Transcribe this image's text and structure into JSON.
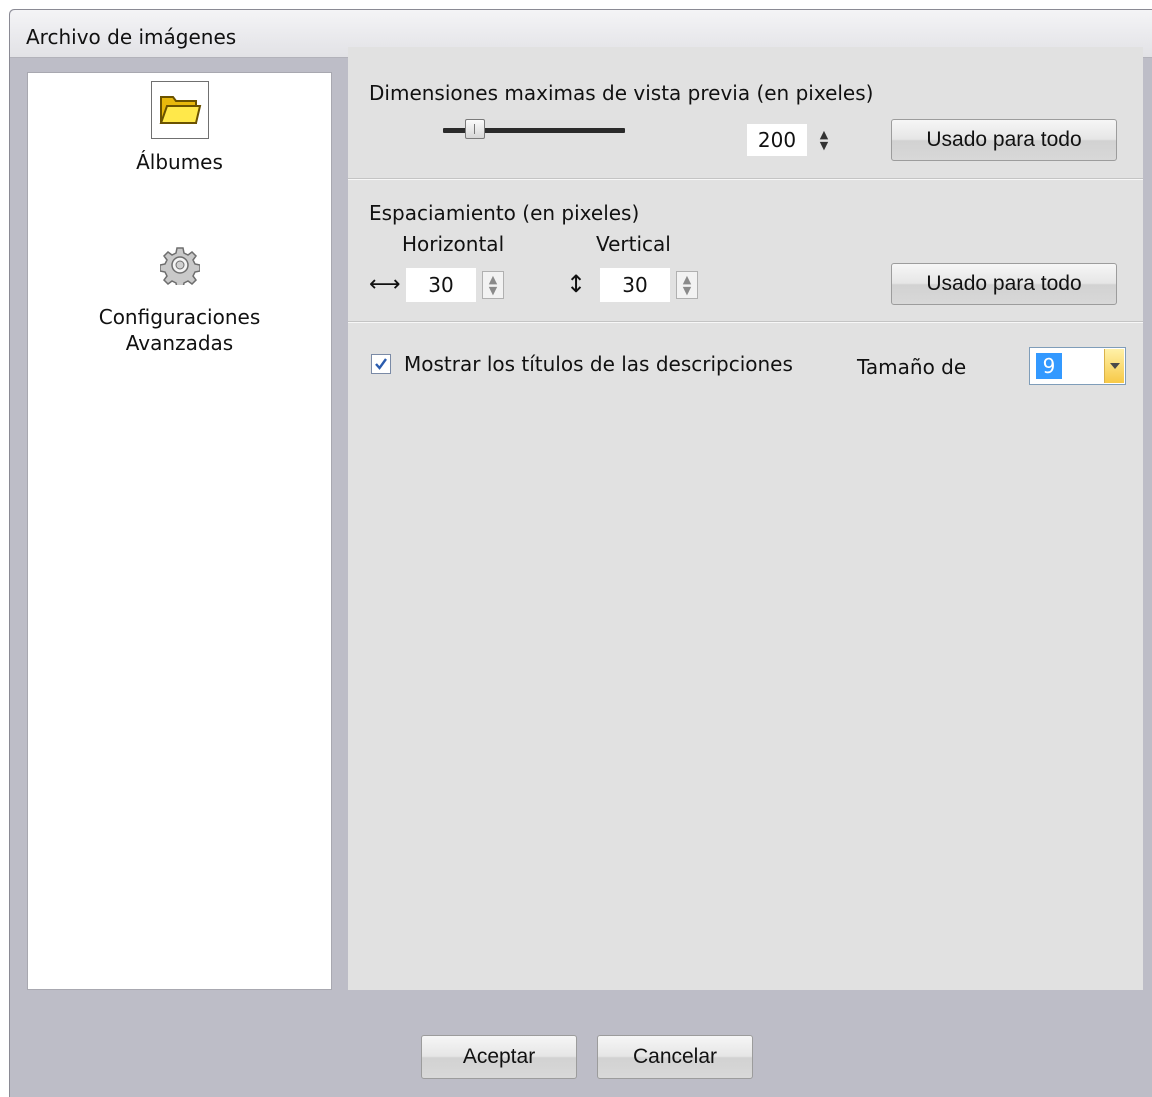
{
  "window": {
    "title": "Archivo de imágenes"
  },
  "sidebar": {
    "items": [
      {
        "label": "Álbumes",
        "icon": "folder-icon",
        "selected": true
      },
      {
        "label": "Configuraciones Avanzadas",
        "label_line1": "Configuraciones",
        "label_line2": "Avanzadas",
        "icon": "gear-icon",
        "selected": false
      }
    ]
  },
  "preview": {
    "heading": "Dimensiones maximas de vista previa (en pixeles)",
    "value": "200",
    "apply_all_label": "Usado para todo"
  },
  "spacing": {
    "heading": "Espaciamiento (en pixeles)",
    "horizontal_label": "Horizontal",
    "vertical_label": "Vertical",
    "horizontal_value": "30",
    "vertical_value": "30",
    "apply_all_label": "Usado para todo"
  },
  "titles": {
    "show_label": "Mostrar los títulos de las descripciones",
    "checked": true,
    "size_label": "Tamaño de",
    "size_value": "9"
  },
  "footer": {
    "ok_label": "Aceptar",
    "cancel_label": "Cancelar"
  },
  "colors": {
    "frame": "#bdbdc7",
    "panel": "#e1e1e1",
    "selection": "#3399ff",
    "combo_arrow": "#f7c947"
  }
}
